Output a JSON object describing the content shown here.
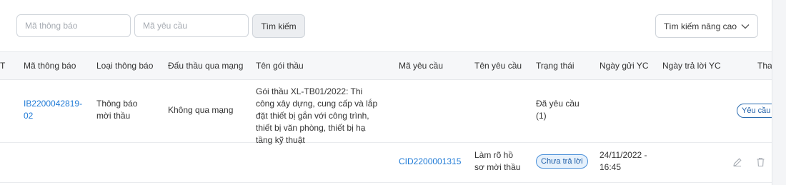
{
  "search": {
    "notice_code_placeholder": "Mã thông báo",
    "request_code_placeholder": "Mã yêu cầu",
    "search_button": "Tìm kiếm",
    "advanced_button": "Tìm kiếm nâng cao"
  },
  "table": {
    "headers": {
      "cut_left": "T",
      "notice_code": "Mã thông báo",
      "notice_type": "Loại thông báo",
      "online_bidding": "Đấu thầu qua mạng",
      "package_name": "Tên gói thầu",
      "request_code": "Mã yêu cầu",
      "request_name": "Tên yêu cầu",
      "status": "Trạng thái",
      "sent_date": "Ngày gửi YC",
      "reply_date": "Ngày trả lời YC",
      "action": "Thao"
    },
    "row1": {
      "notice_code": "IB2200042819-02",
      "notice_type": "Thông báo mời thầu",
      "online_bidding": "Không qua mạng",
      "package_name": "Gói thầu XL-TB01/2022: Thi công xây dựng, cung cấp và lắp đặt thiết bị gắn với công trình, thiết bị văn phòng, thiết bị hạ tầng kỹ thuật",
      "status": "Đã yêu cầu (1)",
      "action_label": "Yêu cầu là"
    },
    "row2": {
      "request_code": "CID2200001315",
      "request_name": "Làm rõ hồ sơ mời thầu",
      "status_badge": "Chưa trả lời",
      "sent_date": "24/11/2022 - 16:45",
      "edit_icon": "pencil-icon",
      "delete_icon": "trash-icon"
    }
  },
  "colors": {
    "link": "#1f7ad6",
    "badge_border": "#2b6cb0",
    "header_bg": "#f6f7f9"
  }
}
